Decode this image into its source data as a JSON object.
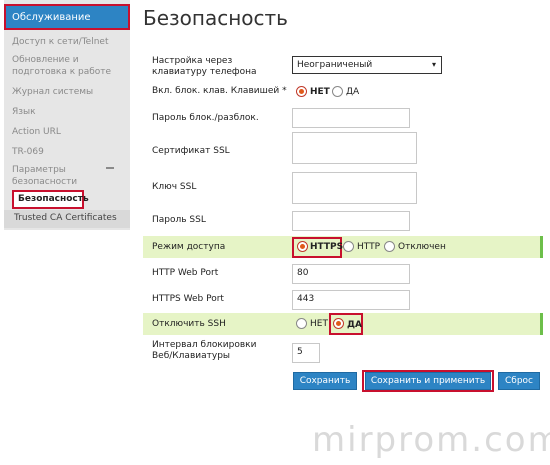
{
  "sidebar": {
    "header": "Обслуживание",
    "items": [
      {
        "label": "Доступ к сети/Telnet"
      },
      {
        "label": "Обновление и подготовка к работе"
      },
      {
        "label": "Журнал системы"
      },
      {
        "label": "Язык"
      },
      {
        "label": "Action URL"
      },
      {
        "label": "TR-069"
      },
      {
        "label": "Параметры безопасности"
      }
    ],
    "active_item": "Безопасность",
    "trusted": "Trusted CA Certificates"
  },
  "main": {
    "title": "Безопасность",
    "keypad_label": "Настройка через клавиатуру телефона",
    "keypad_value": "Неограниченый",
    "lock_key_label": "Вкл. блок. клав. Клавишей *",
    "lock_key_no": "НЕТ",
    "lock_key_yes": "ДА",
    "pin_label": "Пароль блок./разблок.",
    "ssl_cert_label": "Сертификат SSL",
    "ssl_key_label": "Ключ SSL",
    "ssl_pass_label": "Пароль SSL",
    "access_label": "Режим доступа",
    "access_https": "HTTPS",
    "access_http": "HTTP",
    "access_off": "Отключен",
    "http_port_label": "HTTP Web Port",
    "http_port_value": "80",
    "https_port_label": "HTTPS Web Port",
    "https_port_value": "443",
    "ssh_label": "Отключить SSH",
    "ssh_no": "НЕТ",
    "ssh_yes": "ДА",
    "interval_label": "Интервал блокировки Веб/Клавиатуры",
    "interval_value": "5"
  },
  "buttons": {
    "save": "Сохранить",
    "save_apply": "Сохранить и применить",
    "reset": "Сброс"
  },
  "watermark": "mirprom.com",
  "colors": {
    "accent": "#2d84c4",
    "highlight": "#c8102e",
    "band": "#e6f4c6",
    "band_edge": "#6dbf4a",
    "radio_on": "#e05a1a"
  }
}
